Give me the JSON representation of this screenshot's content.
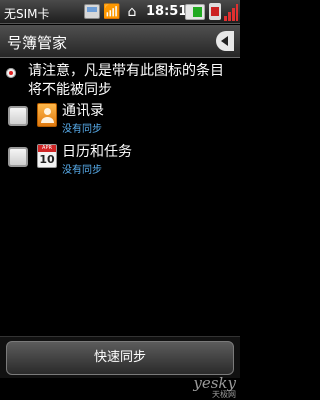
{
  "status_bar": {
    "carrier": "无SIM卡",
    "time": "18:51"
  },
  "header": {
    "title": "号簿管家"
  },
  "notice": {
    "text": "请注意，凡是带有此图标的条目将不能被同步"
  },
  "sync_items": [
    {
      "label": "通讯录",
      "status": "没有同步",
      "icon": "contacts-icon",
      "checked": false
    },
    {
      "label": "日历和任务",
      "status": "没有同步",
      "icon": "calendar-icon",
      "checked": false,
      "icon_month": "APR",
      "icon_day": "10"
    }
  ],
  "actions": {
    "sync_button_label": "快速同步"
  },
  "watermark": {
    "main": "yesky",
    "sub": "天极网"
  }
}
